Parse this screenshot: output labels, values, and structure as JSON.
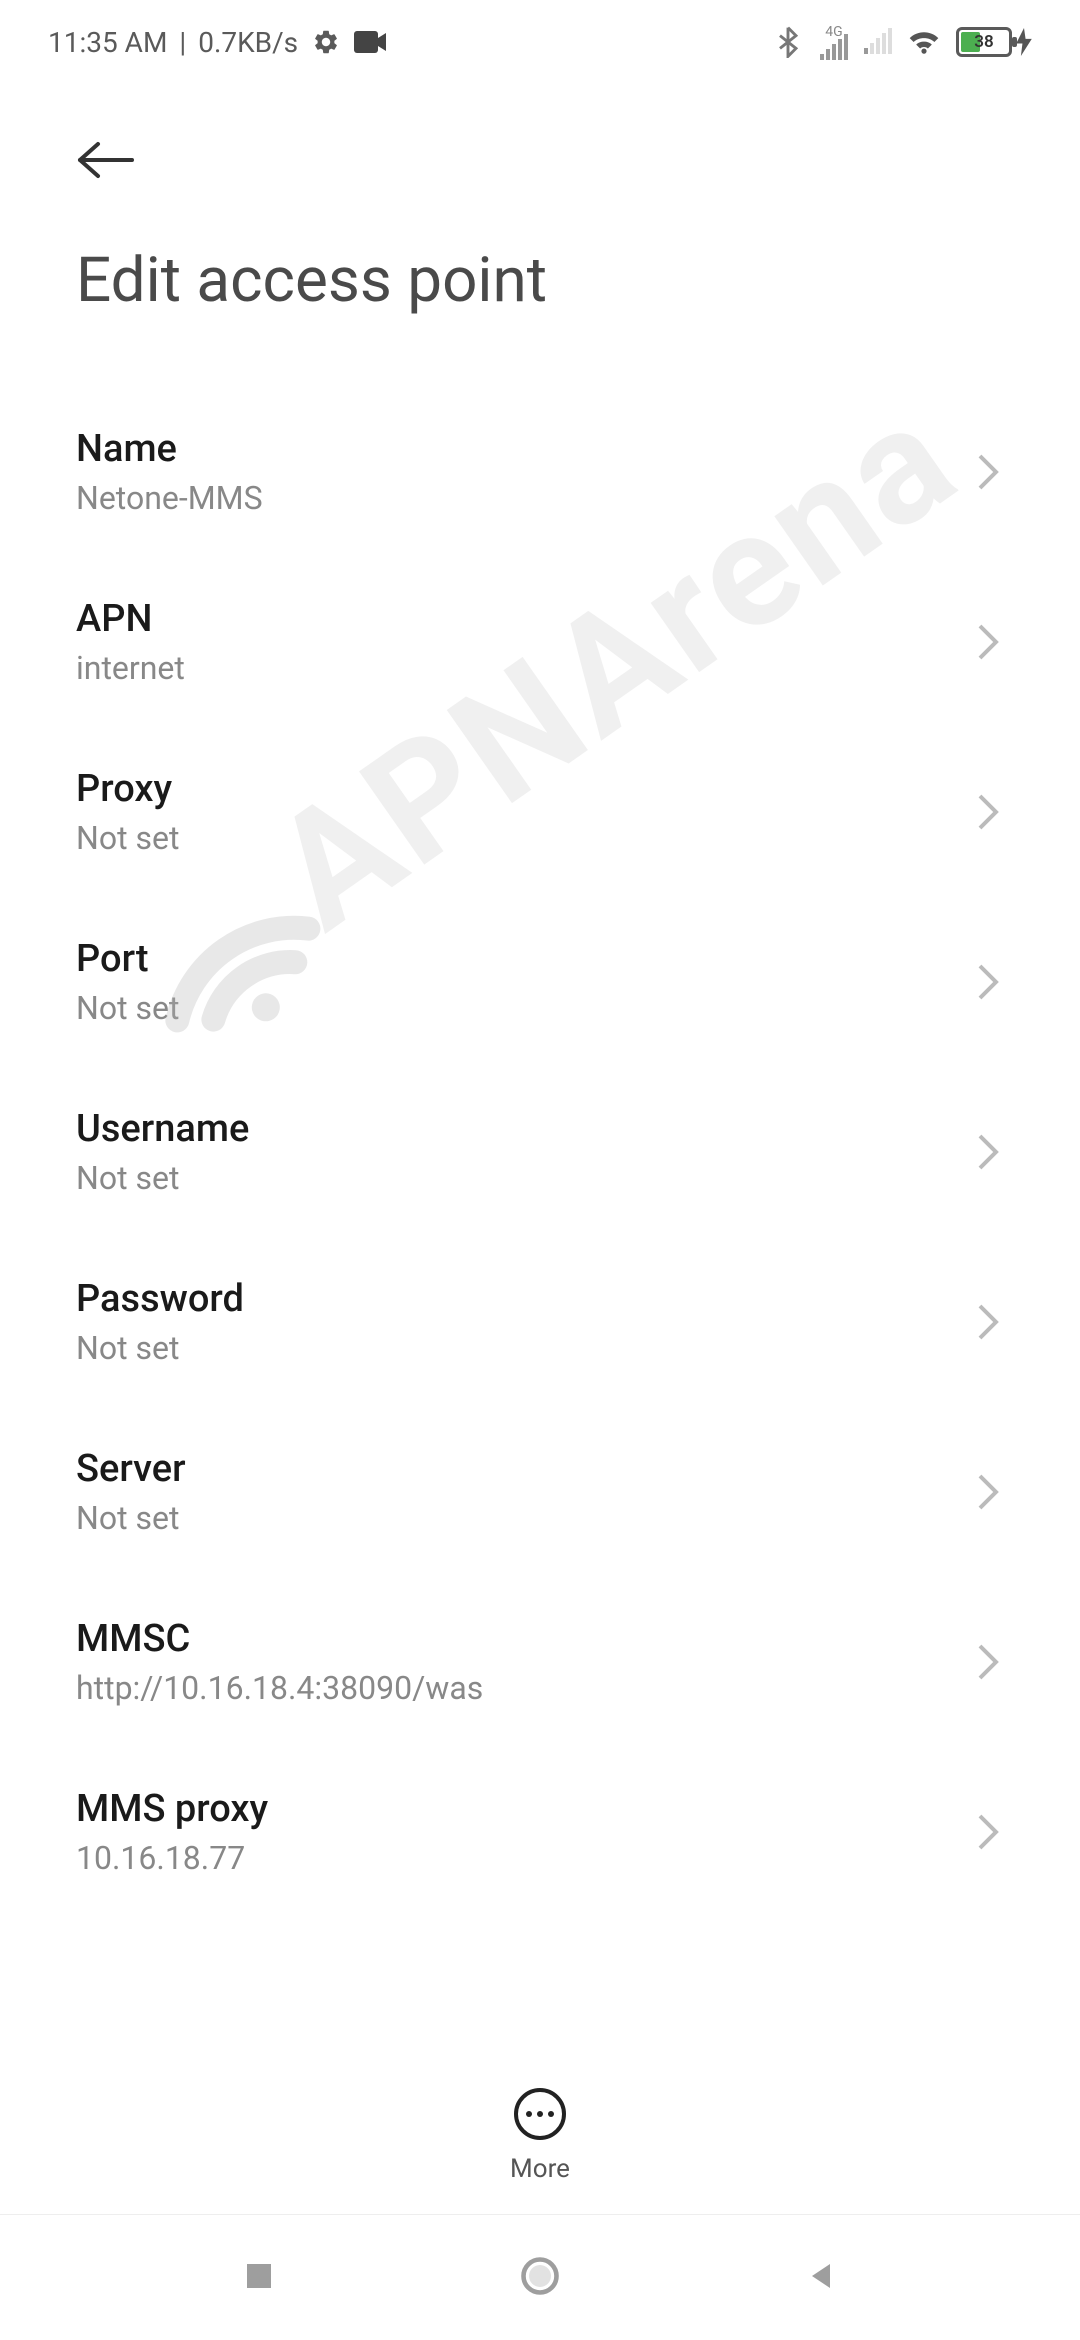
{
  "status": {
    "time": "11:35 AM",
    "separator": "|",
    "net_speed": "0.7KB/s",
    "sig_label": "4G",
    "battery_pct": "38"
  },
  "page": {
    "title": "Edit access point"
  },
  "settings": [
    {
      "label": "Name",
      "value": "Netone-MMS"
    },
    {
      "label": "APN",
      "value": "internet"
    },
    {
      "label": "Proxy",
      "value": "Not set"
    },
    {
      "label": "Port",
      "value": "Not set"
    },
    {
      "label": "Username",
      "value": "Not set"
    },
    {
      "label": "Password",
      "value": "Not set"
    },
    {
      "label": "Server",
      "value": "Not set"
    },
    {
      "label": "MMSC",
      "value": "http://10.16.18.4:38090/was"
    },
    {
      "label": "MMS proxy",
      "value": "10.16.18.77"
    }
  ],
  "footer": {
    "more_label": "More"
  },
  "watermark": {
    "text": "APNArena"
  }
}
